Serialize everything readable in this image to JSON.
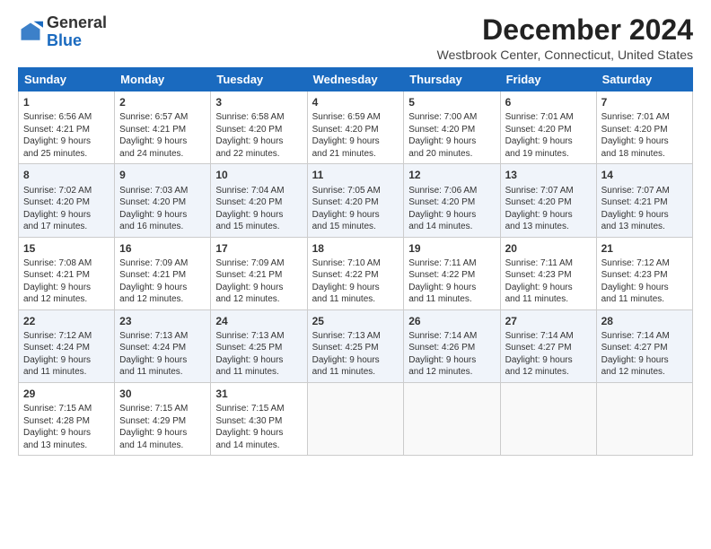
{
  "logo": {
    "general": "General",
    "blue": "Blue"
  },
  "title": "December 2024",
  "subtitle": "Westbrook Center, Connecticut, United States",
  "days_header": [
    "Sunday",
    "Monday",
    "Tuesday",
    "Wednesday",
    "Thursday",
    "Friday",
    "Saturday"
  ],
  "weeks": [
    [
      {
        "day": "1",
        "lines": [
          "Sunrise: 6:56 AM",
          "Sunset: 4:21 PM",
          "Daylight: 9 hours",
          "and 25 minutes."
        ]
      },
      {
        "day": "2",
        "lines": [
          "Sunrise: 6:57 AM",
          "Sunset: 4:21 PM",
          "Daylight: 9 hours",
          "and 24 minutes."
        ]
      },
      {
        "day": "3",
        "lines": [
          "Sunrise: 6:58 AM",
          "Sunset: 4:20 PM",
          "Daylight: 9 hours",
          "and 22 minutes."
        ]
      },
      {
        "day": "4",
        "lines": [
          "Sunrise: 6:59 AM",
          "Sunset: 4:20 PM",
          "Daylight: 9 hours",
          "and 21 minutes."
        ]
      },
      {
        "day": "5",
        "lines": [
          "Sunrise: 7:00 AM",
          "Sunset: 4:20 PM",
          "Daylight: 9 hours",
          "and 20 minutes."
        ]
      },
      {
        "day": "6",
        "lines": [
          "Sunrise: 7:01 AM",
          "Sunset: 4:20 PM",
          "Daylight: 9 hours",
          "and 19 minutes."
        ]
      },
      {
        "day": "7",
        "lines": [
          "Sunrise: 7:01 AM",
          "Sunset: 4:20 PM",
          "Daylight: 9 hours",
          "and 18 minutes."
        ]
      }
    ],
    [
      {
        "day": "8",
        "lines": [
          "Sunrise: 7:02 AM",
          "Sunset: 4:20 PM",
          "Daylight: 9 hours",
          "and 17 minutes."
        ]
      },
      {
        "day": "9",
        "lines": [
          "Sunrise: 7:03 AM",
          "Sunset: 4:20 PM",
          "Daylight: 9 hours",
          "and 16 minutes."
        ]
      },
      {
        "day": "10",
        "lines": [
          "Sunrise: 7:04 AM",
          "Sunset: 4:20 PM",
          "Daylight: 9 hours",
          "and 15 minutes."
        ]
      },
      {
        "day": "11",
        "lines": [
          "Sunrise: 7:05 AM",
          "Sunset: 4:20 PM",
          "Daylight: 9 hours",
          "and 15 minutes."
        ]
      },
      {
        "day": "12",
        "lines": [
          "Sunrise: 7:06 AM",
          "Sunset: 4:20 PM",
          "Daylight: 9 hours",
          "and 14 minutes."
        ]
      },
      {
        "day": "13",
        "lines": [
          "Sunrise: 7:07 AM",
          "Sunset: 4:20 PM",
          "Daylight: 9 hours",
          "and 13 minutes."
        ]
      },
      {
        "day": "14",
        "lines": [
          "Sunrise: 7:07 AM",
          "Sunset: 4:21 PM",
          "Daylight: 9 hours",
          "and 13 minutes."
        ]
      }
    ],
    [
      {
        "day": "15",
        "lines": [
          "Sunrise: 7:08 AM",
          "Sunset: 4:21 PM",
          "Daylight: 9 hours",
          "and 12 minutes."
        ]
      },
      {
        "day": "16",
        "lines": [
          "Sunrise: 7:09 AM",
          "Sunset: 4:21 PM",
          "Daylight: 9 hours",
          "and 12 minutes."
        ]
      },
      {
        "day": "17",
        "lines": [
          "Sunrise: 7:09 AM",
          "Sunset: 4:21 PM",
          "Daylight: 9 hours",
          "and 12 minutes."
        ]
      },
      {
        "day": "18",
        "lines": [
          "Sunrise: 7:10 AM",
          "Sunset: 4:22 PM",
          "Daylight: 9 hours",
          "and 11 minutes."
        ]
      },
      {
        "day": "19",
        "lines": [
          "Sunrise: 7:11 AM",
          "Sunset: 4:22 PM",
          "Daylight: 9 hours",
          "and 11 minutes."
        ]
      },
      {
        "day": "20",
        "lines": [
          "Sunrise: 7:11 AM",
          "Sunset: 4:23 PM",
          "Daylight: 9 hours",
          "and 11 minutes."
        ]
      },
      {
        "day": "21",
        "lines": [
          "Sunrise: 7:12 AM",
          "Sunset: 4:23 PM",
          "Daylight: 9 hours",
          "and 11 minutes."
        ]
      }
    ],
    [
      {
        "day": "22",
        "lines": [
          "Sunrise: 7:12 AM",
          "Sunset: 4:24 PM",
          "Daylight: 9 hours",
          "and 11 minutes."
        ]
      },
      {
        "day": "23",
        "lines": [
          "Sunrise: 7:13 AM",
          "Sunset: 4:24 PM",
          "Daylight: 9 hours",
          "and 11 minutes."
        ]
      },
      {
        "day": "24",
        "lines": [
          "Sunrise: 7:13 AM",
          "Sunset: 4:25 PM",
          "Daylight: 9 hours",
          "and 11 minutes."
        ]
      },
      {
        "day": "25",
        "lines": [
          "Sunrise: 7:13 AM",
          "Sunset: 4:25 PM",
          "Daylight: 9 hours",
          "and 11 minutes."
        ]
      },
      {
        "day": "26",
        "lines": [
          "Sunrise: 7:14 AM",
          "Sunset: 4:26 PM",
          "Daylight: 9 hours",
          "and 12 minutes."
        ]
      },
      {
        "day": "27",
        "lines": [
          "Sunrise: 7:14 AM",
          "Sunset: 4:27 PM",
          "Daylight: 9 hours",
          "and 12 minutes."
        ]
      },
      {
        "day": "28",
        "lines": [
          "Sunrise: 7:14 AM",
          "Sunset: 4:27 PM",
          "Daylight: 9 hours",
          "and 12 minutes."
        ]
      }
    ],
    [
      {
        "day": "29",
        "lines": [
          "Sunrise: 7:15 AM",
          "Sunset: 4:28 PM",
          "Daylight: 9 hours",
          "and 13 minutes."
        ]
      },
      {
        "day": "30",
        "lines": [
          "Sunrise: 7:15 AM",
          "Sunset: 4:29 PM",
          "Daylight: 9 hours",
          "and 14 minutes."
        ]
      },
      {
        "day": "31",
        "lines": [
          "Sunrise: 7:15 AM",
          "Sunset: 4:30 PM",
          "Daylight: 9 hours",
          "and 14 minutes."
        ]
      },
      null,
      null,
      null,
      null
    ]
  ]
}
